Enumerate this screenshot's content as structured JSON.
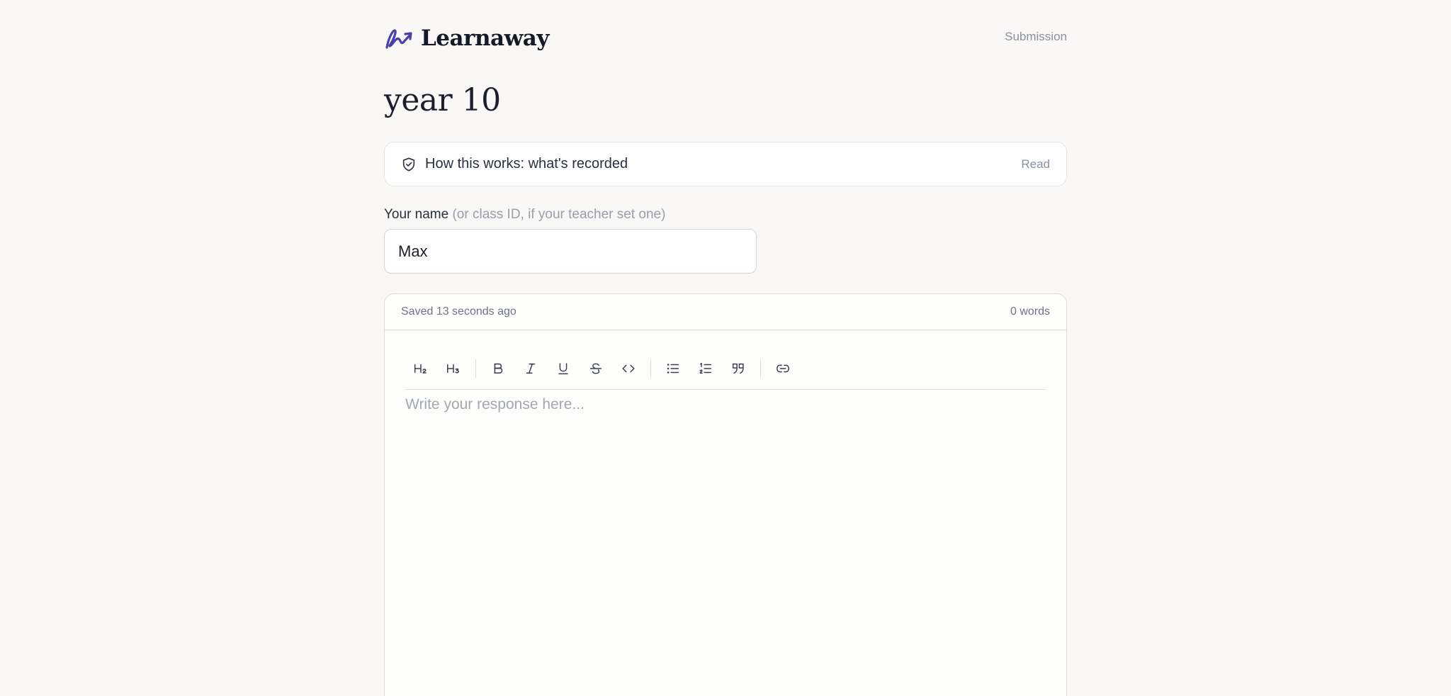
{
  "header": {
    "brand_name": "Learnaway",
    "nav_link": "Submission"
  },
  "page": {
    "title": "year 10"
  },
  "info_banner": {
    "title": "How this works: what's recorded",
    "action": "Read"
  },
  "name_field": {
    "label": "Your name",
    "hint": "(or class ID, if your teacher set one)",
    "value": "Max"
  },
  "editor": {
    "save_status": "Saved 13 seconds ago",
    "word_count": "0 words",
    "placeholder": "Write your response here...",
    "toolbar": [
      "heading-2",
      "heading-3",
      "bold",
      "italic",
      "underline",
      "strikethrough",
      "code",
      "bullet-list",
      "ordered-list",
      "blockquote",
      "link"
    ]
  },
  "colors": {
    "background": "#f9f8f6",
    "brand_accent": "#4b3fa8",
    "text_primary": "#1b1e2b",
    "text_muted": "#8b90a0"
  }
}
